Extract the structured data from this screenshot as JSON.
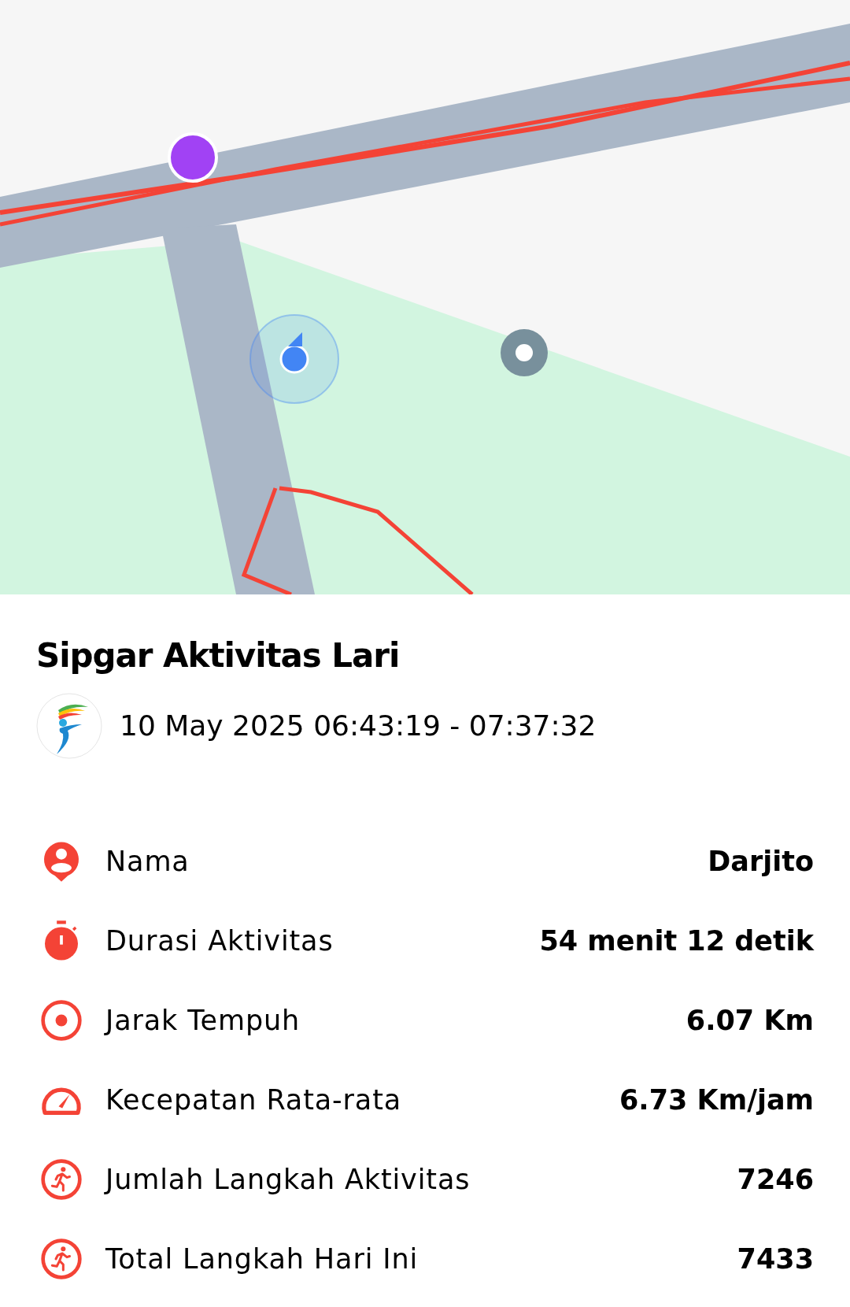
{
  "title": "Sipgar Aktivitas Lari",
  "time_range": "10 May 2025 06:43:19 - 07:37:32",
  "stats": [
    {
      "kind": "person",
      "label": "Nama",
      "value": "Darjito"
    },
    {
      "kind": "stopwatch",
      "label": "Durasi Aktivitas",
      "value": "54 menit 12 detik"
    },
    {
      "kind": "target",
      "label": "Jarak Tempuh",
      "value": "6.07 Km"
    },
    {
      "kind": "speedometer",
      "label": "Kecepatan Rata-rata",
      "value": "6.73 Km/jam"
    },
    {
      "kind": "runner",
      "label": "Jumlah Langkah Aktivitas",
      "value": "7246"
    },
    {
      "kind": "runner",
      "label": "Total Langkah Hari Ini",
      "value": "7433"
    }
  ]
}
